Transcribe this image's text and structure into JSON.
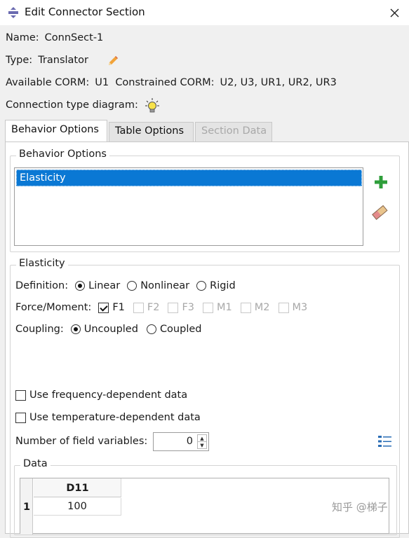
{
  "window": {
    "title": "Edit Connector Section"
  },
  "fields": {
    "name_label": "Name:",
    "name_value": "ConnSect-1",
    "type_label": "Type:",
    "type_value": "Translator",
    "available_label": "Available CORM:",
    "available_value": "U1",
    "constrained_label": "Constrained CORM:",
    "constrained_value": "U2, U3, UR1, UR2, UR3",
    "diagram_label": "Connection type diagram:"
  },
  "tabs": [
    {
      "label": "Behavior Options",
      "state": "active"
    },
    {
      "label": "Table Options",
      "state": "normal"
    },
    {
      "label": "Section Data",
      "state": "disabled"
    }
  ],
  "behavior_group": {
    "title": "Behavior Options",
    "items": [
      "Elasticity"
    ],
    "selected": "Elasticity"
  },
  "elasticity_group": {
    "title": "Elasticity",
    "definition_label": "Definition:",
    "definition_options": [
      "Linear",
      "Nonlinear",
      "Rigid"
    ],
    "definition_selected": "Linear",
    "force_label": "Force/Moment:",
    "force_options": [
      {
        "label": "F1",
        "checked": true,
        "enabled": true
      },
      {
        "label": "F2",
        "checked": false,
        "enabled": false
      },
      {
        "label": "F3",
        "checked": false,
        "enabled": false
      },
      {
        "label": "M1",
        "checked": false,
        "enabled": false
      },
      {
        "label": "M2",
        "checked": false,
        "enabled": false
      },
      {
        "label": "M3",
        "checked": false,
        "enabled": false
      }
    ],
    "coupling_label": "Coupling:",
    "coupling_options": [
      "Uncoupled",
      "Coupled"
    ],
    "coupling_selected": "Uncoupled",
    "freq_label": "Use frequency-dependent data",
    "temp_label": "Use temperature-dependent data",
    "field_vars_label": "Number of field variables:",
    "field_vars_value": "0"
  },
  "data_group": {
    "title": "Data",
    "header": "D11",
    "rows": [
      {
        "index": "1",
        "value": "100"
      }
    ]
  },
  "watermark": "知乎 @梯子",
  "colors": {
    "selection": "#0a78d4",
    "add_icon": "#2e9e3a"
  }
}
